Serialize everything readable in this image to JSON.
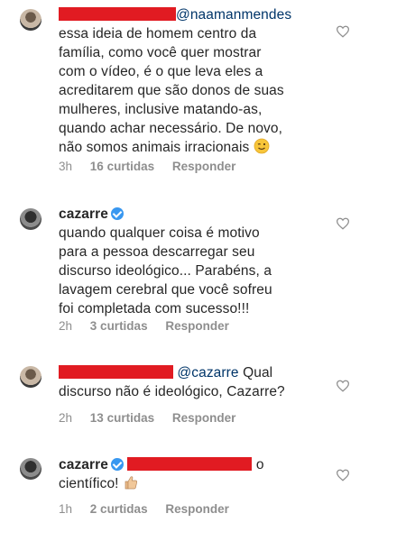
{
  "comments": [
    {
      "mention": "@naamanmendes",
      "lines": [
        "essa ideia de homem centro da",
        "família, como você quer mostrar",
        "com o vídeo, é o que leva eles a",
        "acreditarem que são donos de suas",
        "mulheres, inclusive matando-as,",
        "quando achar necessário. De novo,",
        "não somos animais irracionais"
      ],
      "emoji": "wink-emoji",
      "time": "3h",
      "likes": "16 curtidas",
      "reply": "Responder"
    },
    {
      "username": "cazarre",
      "lines": [
        "quando qualquer coisa é motivo",
        "para a pessoa descarregar seu",
        "discurso ideológico... Parabéns, a",
        "lavagem cerebral que você sofreu",
        "foi completada com sucesso!!!"
      ],
      "time": "2h",
      "likes": "3 curtidas",
      "reply": "Responder"
    },
    {
      "mention": "@cazarre",
      "text_after_mention": "Qual",
      "lines": [
        "discurso não é ideológico, Cazarre?"
      ],
      "time": "2h",
      "likes": "13 curtidas",
      "reply": "Responder"
    },
    {
      "username": "cazarre",
      "text_after_redaction": "o",
      "lines": [
        "científico!"
      ],
      "emoji": "thumbs-up-emoji",
      "time": "1h",
      "likes": "2 curtidas",
      "reply": "Responder"
    }
  ],
  "colors": {
    "redaction": "#e11b22",
    "verified": "#3897f0",
    "meta": "#8e8e8e",
    "mention": "#003569"
  }
}
